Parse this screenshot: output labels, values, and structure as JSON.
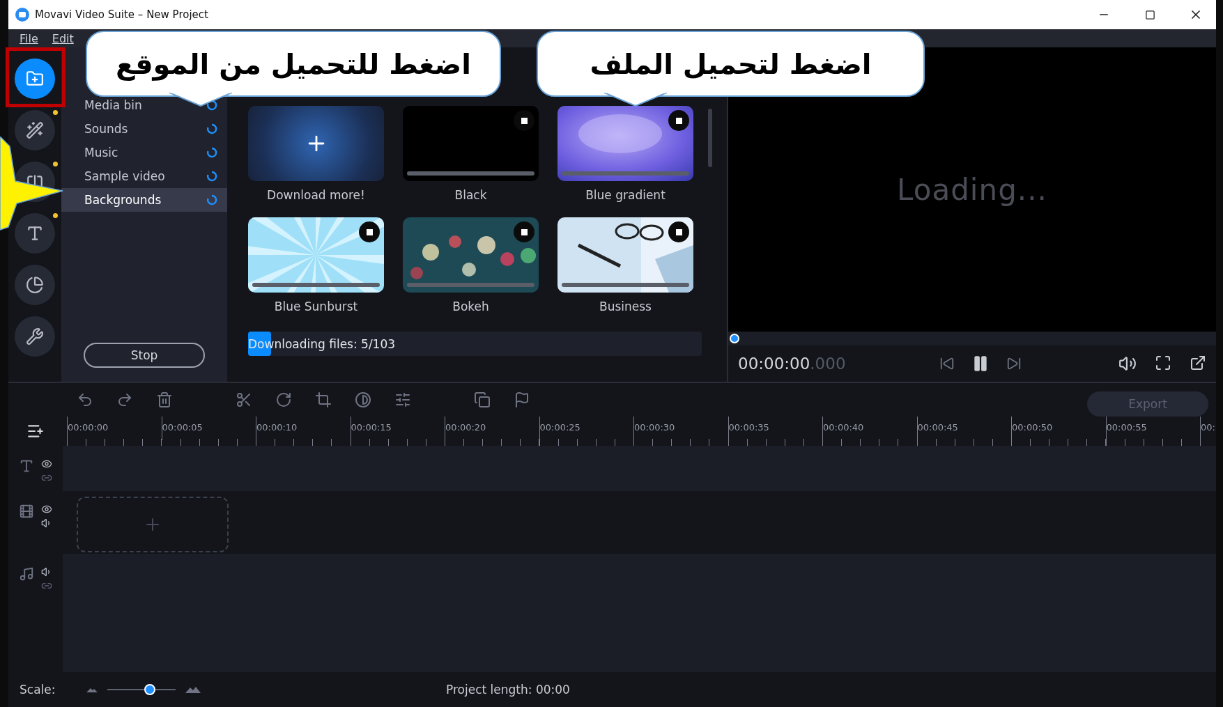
{
  "window": {
    "title": "Movavi Video Suite – New Project"
  },
  "menu": [
    "File",
    "Edit"
  ],
  "tool_rail": [
    {
      "kind": "import",
      "selected": true,
      "new": false
    },
    {
      "kind": "filters",
      "selected": false,
      "new": true
    },
    {
      "kind": "transitions",
      "selected": false,
      "new": true
    },
    {
      "kind": "titles",
      "selected": false,
      "new": true
    },
    {
      "kind": "stickers",
      "selected": false,
      "new": false
    },
    {
      "kind": "tools",
      "selected": false,
      "new": false
    }
  ],
  "categories": [
    {
      "label": "Media bin",
      "selected": false
    },
    {
      "label": "Sounds",
      "selected": false
    },
    {
      "label": "Music",
      "selected": false
    },
    {
      "label": "Sample video",
      "selected": false
    },
    {
      "label": "Backgrounds",
      "selected": true
    }
  ],
  "stop_button": "Stop",
  "media": [
    {
      "label": "Download more!",
      "kind": "add"
    },
    {
      "label": "Black",
      "kind": "background",
      "level": 0
    },
    {
      "label": "Blue gradient",
      "kind": "background",
      "level": 0
    },
    {
      "label": "Blue Sunburst",
      "kind": "background",
      "level": 0
    },
    {
      "label": "Bokeh",
      "kind": "background",
      "level": 0
    },
    {
      "label": "Business",
      "kind": "background",
      "level": 0
    }
  ],
  "download_progress": {
    "label": "Downloading files: 5/103",
    "level": 0.05
  },
  "preview": {
    "status": "Loading...",
    "timecode": "00:00:00",
    "timecode_ms": ".000",
    "seek": {
      "level": 0
    }
  },
  "export_button": "Export",
  "ruler": [
    "00:00:00",
    "00:00:05",
    "00:00:10",
    "00:00:15",
    "00:00:20",
    "00:00:25",
    "00:00:30",
    "00:00:35",
    "00:00:40",
    "00:00:45",
    "00:00:50",
    "00:00:55",
    "00:"
  ],
  "tracks": [
    {
      "kind": "text"
    },
    {
      "kind": "video"
    },
    {
      "kind": "audio"
    }
  ],
  "status": {
    "scale_label": "Scale:",
    "scale_slider": {
      "level": 0.62
    },
    "project_length": "Project length: 00:00"
  },
  "callouts": [
    {
      "text": "اضغط لتحميل الملف"
    },
    {
      "text": "اضغط للتحميل من الموقع"
    }
  ]
}
